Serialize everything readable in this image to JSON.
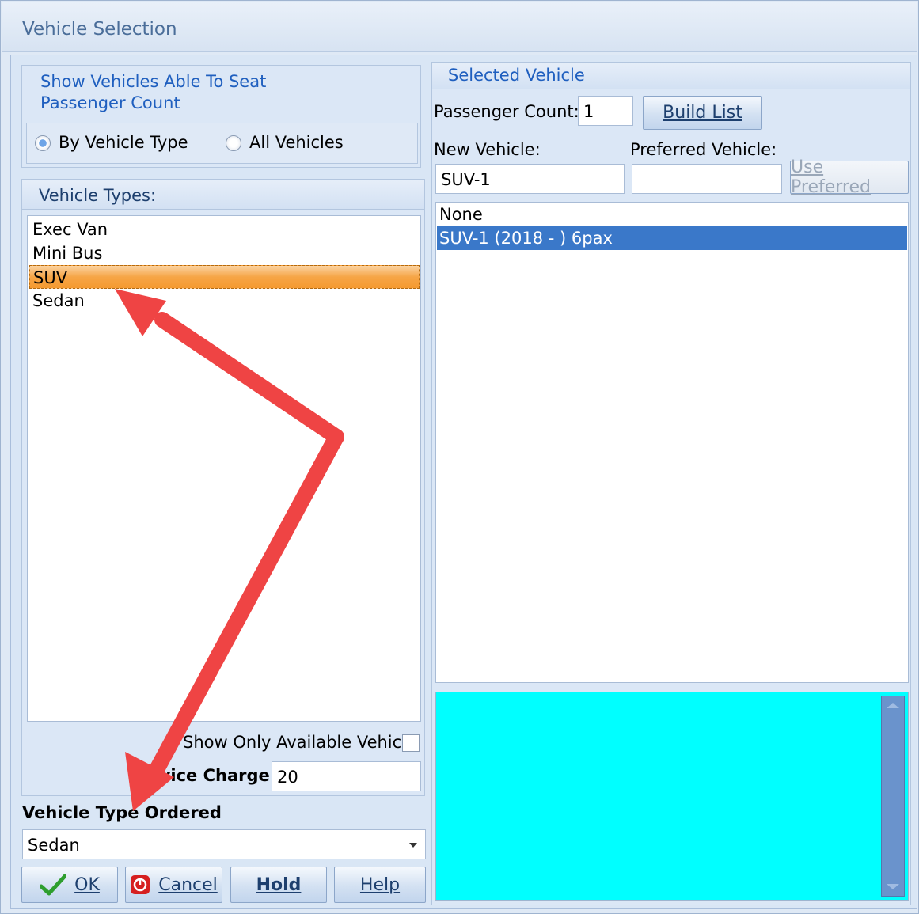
{
  "window": {
    "title": "Vehicle Selection"
  },
  "filter": {
    "heading_line1": "Show Vehicles Able To Seat",
    "heading_line2": "Passenger Count",
    "radio_by_type": "By Vehicle Type",
    "radio_all": "All Vehicles",
    "selected": "By Vehicle Type"
  },
  "vehicle_types": {
    "label": "Vehicle Types:",
    "items": [
      "Exec Van",
      "Mini Bus",
      "SUV",
      "Sedan"
    ],
    "selected": "SUV"
  },
  "show_only_available": {
    "label": "Show Only Available Vehicle",
    "checked": false
  },
  "service_charge": {
    "label": "Service Charge",
    "value": "20"
  },
  "vehicle_type_ordered": {
    "label": "Vehicle Type Ordered",
    "value": "Sedan"
  },
  "buttons": {
    "ok": "OK",
    "cancel": "Cancel",
    "hold": "Hold",
    "help": "Help"
  },
  "selected_vehicle": {
    "heading": "Selected Vehicle",
    "passenger_count_label": "Passenger Count:",
    "passenger_count_value": "1",
    "build_list": "Build List",
    "new_vehicle_label": "New Vehicle:",
    "new_vehicle_value": "SUV-1",
    "preferred_vehicle_label": "Preferred Vehicle:",
    "preferred_vehicle_value": "",
    "use_preferred": "Use Preferred",
    "list": [
      "None",
      "SUV-1 (2018 - ) 6pax"
    ],
    "list_selected": "SUV-1 (2018 - ) 6pax"
  },
  "colors": {
    "info_panel": "#00ffff",
    "annotation_arrow": "#ef4444",
    "selection_orange": "#f6a546",
    "selection_blue": "#3a78c9"
  }
}
